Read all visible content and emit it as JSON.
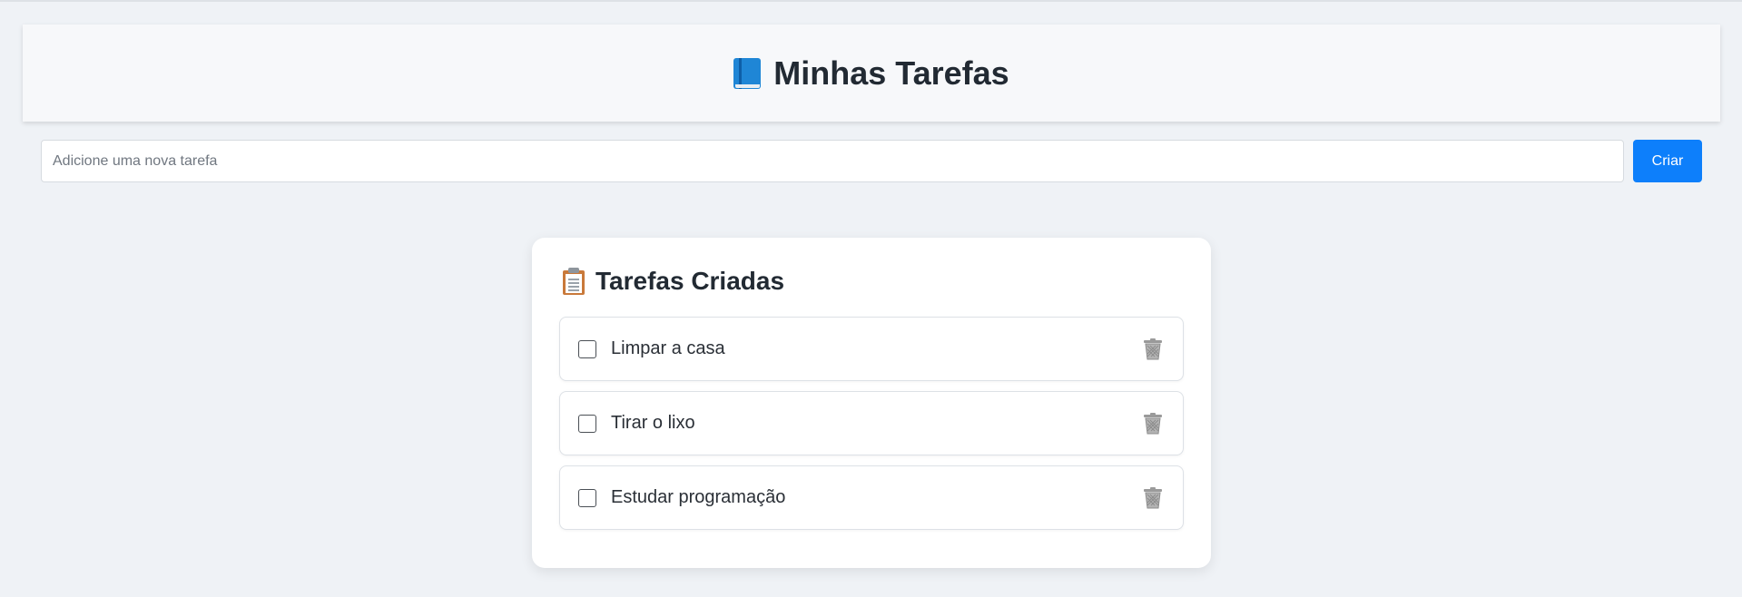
{
  "header": {
    "title": "Minhas Tarefas",
    "icon": "blue-book-icon"
  },
  "add_task": {
    "placeholder": "Adicione uma nova tarefa",
    "value": "",
    "button_label": "Criar"
  },
  "task_card": {
    "title": "Tarefas Criadas",
    "icon": "clipboard-icon",
    "items": [
      {
        "text": "Limpar a casa",
        "checked": false
      },
      {
        "text": "Tirar o lixo",
        "checked": false
      },
      {
        "text": "Estudar programação",
        "checked": false
      }
    ]
  },
  "colors": {
    "accent": "#0d7ffb",
    "background": "#eff2f6",
    "card": "#ffffff"
  }
}
